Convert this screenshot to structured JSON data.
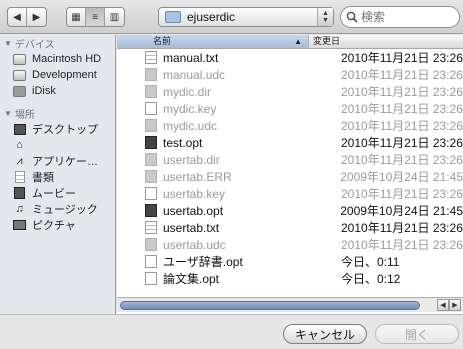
{
  "toolbar": {
    "folder_name": "ejuserdic",
    "search_placeholder": "検索"
  },
  "sidebar": {
    "devices_header": "デバイス",
    "devices": [
      {
        "label": "Macintosh HD",
        "icon": "hard-disk-icon"
      },
      {
        "label": "Development",
        "icon": "hard-disk-icon"
      },
      {
        "label": "iDisk",
        "icon": "idisk-icon"
      }
    ],
    "places_header": "場所",
    "places": [
      {
        "label": "デスクトップ",
        "icon": "desktop-icon"
      },
      {
        "label": "",
        "icon": "home-icon"
      },
      {
        "label": "アプリケー…",
        "icon": "applications-icon"
      },
      {
        "label": "書類",
        "icon": "documents-icon"
      },
      {
        "label": "ムービー",
        "icon": "movies-icon"
      },
      {
        "label": "ミュージック",
        "icon": "music-icon"
      },
      {
        "label": "ピクチャ",
        "icon": "pictures-icon"
      }
    ]
  },
  "list": {
    "col_name": "名前",
    "col_date": "変更日",
    "rows": [
      {
        "name": "manual.txt",
        "date": "2010年11月21日 23:26",
        "dim": false,
        "icon": "doc"
      },
      {
        "name": "manual.udc",
        "date": "2010年11月21日 23:26",
        "dim": true,
        "icon": "gen"
      },
      {
        "name": "mydic.dir",
        "date": "2010年11月21日 23:26",
        "dim": true,
        "icon": "gen"
      },
      {
        "name": "mydic.key",
        "date": "2010年11月21日 23:26",
        "dim": true,
        "icon": "key"
      },
      {
        "name": "mydic.udc",
        "date": "2010年11月21日 23:26",
        "dim": true,
        "icon": "gen"
      },
      {
        "name": "test.opt",
        "date": "2010年11月21日 23:26",
        "dim": false,
        "icon": "dark"
      },
      {
        "name": "usertab.dir",
        "date": "2010年11月21日 23:26",
        "dim": true,
        "icon": "gen"
      },
      {
        "name": "usertab.ERR",
        "date": "2009年10月24日 21:45",
        "dim": true,
        "icon": "gen"
      },
      {
        "name": "usertab.key",
        "date": "2010年11月21日 23:26",
        "dim": true,
        "icon": "key"
      },
      {
        "name": "usertab.opt",
        "date": "2009年10月24日 21:45",
        "dim": false,
        "icon": "dark"
      },
      {
        "name": "usertab.txt",
        "date": "2010年11月21日 23:26",
        "dim": false,
        "icon": "doc"
      },
      {
        "name": "usertab.udc",
        "date": "2010年11月21日 23:26",
        "dim": true,
        "icon": "gen"
      },
      {
        "name": "ユーザ辞書.opt",
        "date": "今日、0:11",
        "dim": false,
        "icon": "blank"
      },
      {
        "name": "論文集.opt",
        "date": "今日、0:12",
        "dim": false,
        "icon": "blank"
      }
    ]
  },
  "footer": {
    "cancel_label": "キャンセル",
    "open_label": "開く"
  }
}
